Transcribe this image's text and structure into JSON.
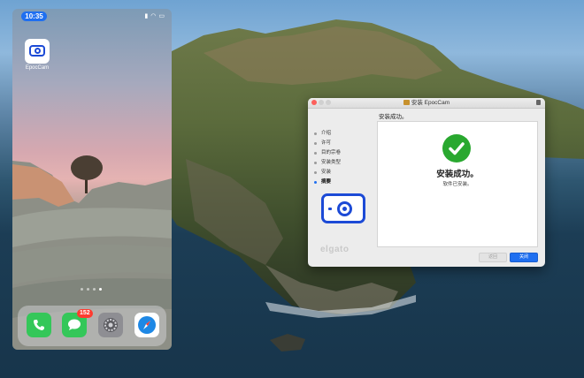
{
  "phone": {
    "status_time": "10:35",
    "status_icons": [
      "signal-icon",
      "wifi-icon",
      "battery-icon"
    ],
    "home_app": {
      "label": "EpocCam",
      "icon": "camera-icon"
    },
    "page_indicator": {
      "count": 4,
      "active": 3
    },
    "dock": [
      {
        "name": "phone",
        "icon": "phone-icon",
        "color": "#2ecc40"
      },
      {
        "name": "messages",
        "icon": "messages-icon",
        "color": "#2ecc40",
        "badge": "152"
      },
      {
        "name": "settings",
        "icon": "gear-icon",
        "color": "#8e8e93"
      },
      {
        "name": "safari",
        "icon": "compass-icon",
        "color": "#1e88e5"
      }
    ]
  },
  "installer": {
    "title": "安装 EpocCam",
    "heading": "安装成功。",
    "steps": [
      {
        "label": "介绍",
        "active": false
      },
      {
        "label": "许可",
        "active": false
      },
      {
        "label": "目的宗卷",
        "active": false
      },
      {
        "label": "安装类型",
        "active": false
      },
      {
        "label": "安装",
        "active": false
      },
      {
        "label": "摘要",
        "active": true
      }
    ],
    "success_title": "安装成功。",
    "success_subtitle": "软件已安装。",
    "brand": "elgato",
    "buttons": {
      "back": "返回",
      "close": "关闭"
    },
    "colors": {
      "accent": "#1f6ff0",
      "success": "#29a82f",
      "icon_blue": "#1c4ad6"
    }
  }
}
